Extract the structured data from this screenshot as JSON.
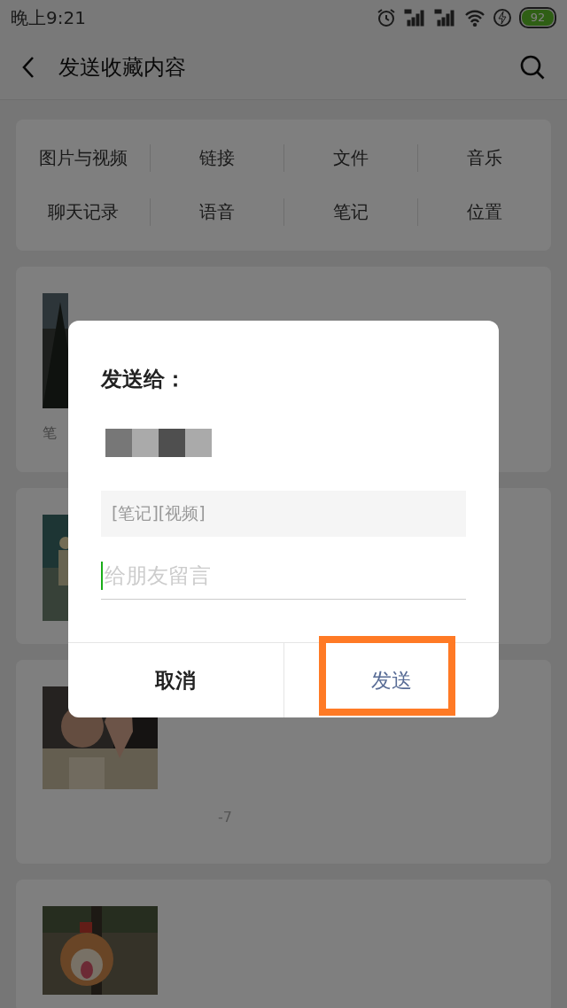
{
  "status_bar": {
    "time": "晚上9:21",
    "battery": "92"
  },
  "header": {
    "title": "发送收藏内容"
  },
  "categories": [
    {
      "label": "图片与视频"
    },
    {
      "label": "链接"
    },
    {
      "label": "文件"
    },
    {
      "label": "音乐"
    },
    {
      "label": "聊天记录"
    },
    {
      "label": "语音"
    },
    {
      "label": "笔记"
    },
    {
      "label": "位置"
    }
  ],
  "items": [
    {
      "kind": "picture",
      "tag": "笔"
    },
    {
      "kind": "picture"
    },
    {
      "kind": "picture",
      "meta": "-7"
    },
    {
      "kind": "picture"
    }
  ],
  "dialog": {
    "title": "发送给：",
    "preview": "[笔记][视频]",
    "message": {
      "placeholder": "给朋友留言"
    },
    "buttons": [
      {
        "label": "取消",
        "kind": "cancel",
        "highlighted": false
      },
      {
        "label": "发送",
        "kind": "confirm",
        "highlighted": true
      }
    ]
  }
}
